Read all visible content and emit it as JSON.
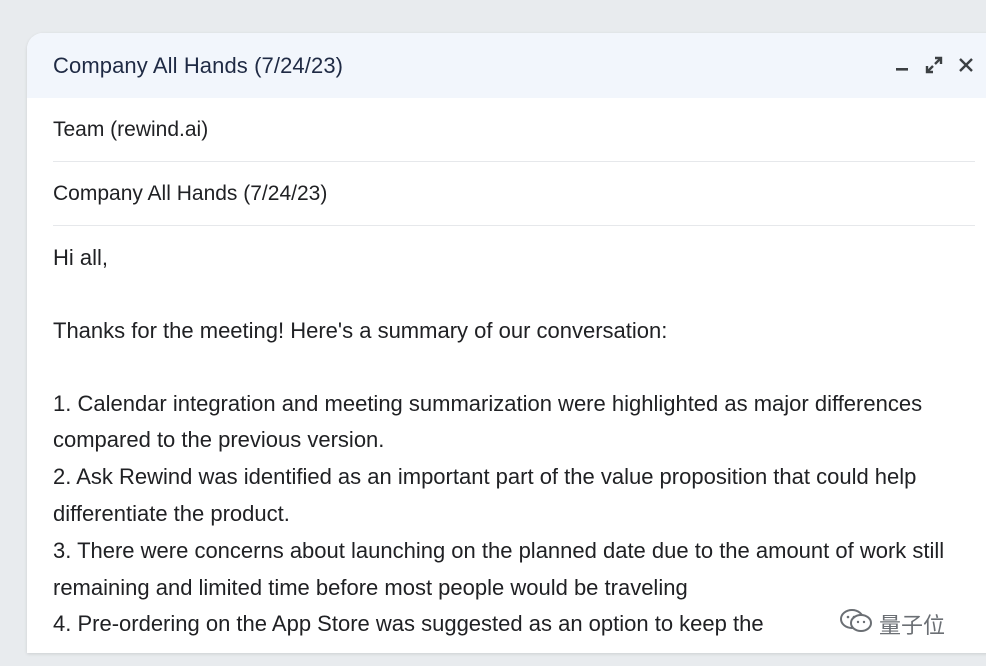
{
  "compose": {
    "title": "Company All Hands (7/24/23)",
    "controls": {
      "minimize_icon": "minimize-icon",
      "expand_icon": "expand-icon",
      "close_icon": "close-icon"
    },
    "to": "Team (rewind.ai)",
    "subject": "Company All Hands (7/24/23)",
    "body": {
      "greeting": "Hi all,",
      "intro": "Thanks for the meeting! Here's a summary of our conversation:",
      "items": [
        "1. Calendar integration and meeting summarization were highlighted as major differences compared to the previous version.",
        "2. Ask Rewind was identified as an important part of the value proposition that could help differentiate the product.",
        "3. There were concerns about launching on the planned date due to the amount of work still remaining and limited time before most people would be traveling",
        "4. Pre-ordering on the App Store was suggested as an option to keep the"
      ]
    }
  },
  "watermark": {
    "text": "量子位",
    "icon": "wechat-icon"
  },
  "colors": {
    "header_bg": "#f2f6fc",
    "page_bg": "#e8ebee",
    "title": "#1f2a44",
    "text": "#202124"
  }
}
